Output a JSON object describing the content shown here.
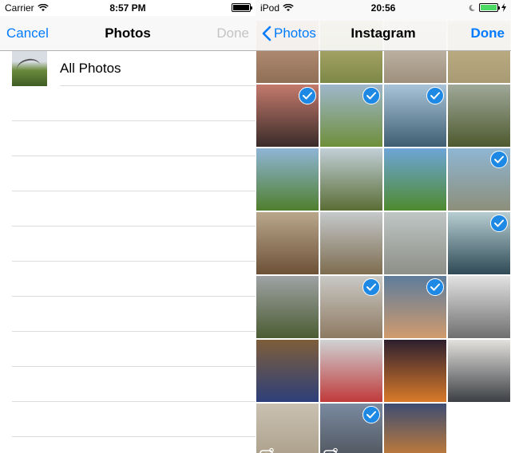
{
  "left": {
    "status": {
      "carrier": "Carrier",
      "time": "8:57 PM"
    },
    "nav": {
      "left": "Cancel",
      "title": "Photos",
      "right": "Done"
    },
    "albums": [
      {
        "label": "All Photos"
      }
    ]
  },
  "right": {
    "status": {
      "device": "iPod",
      "time": "20:56"
    },
    "nav": {
      "back": "Photos",
      "title": "Instagram",
      "right": "Done"
    },
    "photos": [
      {
        "colors": [
          "#caa089",
          "#8f6f55"
        ],
        "selected": false,
        "instagram": false
      },
      {
        "colors": [
          "#c7b87f",
          "#7c8847"
        ],
        "selected": false,
        "instagram": false
      },
      {
        "colors": [
          "#d8d0c4",
          "#9d8f7b"
        ],
        "selected": false,
        "instagram": false
      },
      {
        "colors": [
          "#c8b88e",
          "#a89a73"
        ],
        "selected": false,
        "instagram": false
      },
      {
        "colors": [
          "#c47a6c",
          "#3a2b29"
        ],
        "selected": true,
        "instagram": false
      },
      {
        "colors": [
          "#9eb7cc",
          "#6f8f3a"
        ],
        "selected": true,
        "instagram": false
      },
      {
        "colors": [
          "#a9c4d8",
          "#3f5e72"
        ],
        "selected": true,
        "instagram": false
      },
      {
        "colors": [
          "#a0a899",
          "#4e5a2f"
        ],
        "selected": false,
        "instagram": false
      },
      {
        "colors": [
          "#8fb5d6",
          "#4f7f2d"
        ],
        "selected": false,
        "instagram": false
      },
      {
        "colors": [
          "#c1cfd7",
          "#5a6d35"
        ],
        "selected": false,
        "instagram": false
      },
      {
        "colors": [
          "#6ea5d8",
          "#4e8a2e"
        ],
        "selected": false,
        "instagram": false
      },
      {
        "colors": [
          "#8eb6d3",
          "#8d8f7a"
        ],
        "selected": true,
        "instagram": false
      },
      {
        "colors": [
          "#b9a78c",
          "#6d5137"
        ],
        "selected": false,
        "instagram": false
      },
      {
        "colors": [
          "#c5c9cb",
          "#7d6c4f"
        ],
        "selected": false,
        "instagram": false
      },
      {
        "colors": [
          "#bfc6c4",
          "#8d8f88"
        ],
        "selected": false,
        "instagram": false
      },
      {
        "colors": [
          "#b6cdd1",
          "#2f4a56"
        ],
        "selected": true,
        "instagram": false
      },
      {
        "colors": [
          "#9fa2a4",
          "#4b5c33"
        ],
        "selected": false,
        "instagram": false
      },
      {
        "colors": [
          "#c9c9c5",
          "#8e7a62"
        ],
        "selected": true,
        "instagram": false
      },
      {
        "colors": [
          "#5d7c9c",
          "#d19b6d"
        ],
        "selected": true,
        "instagram": false
      },
      {
        "colors": [
          "#e2e2e2",
          "#6f6f6f"
        ],
        "selected": false,
        "instagram": false
      },
      {
        "colors": [
          "#7e5e3a",
          "#2d3f7a"
        ],
        "selected": false,
        "instagram": false
      },
      {
        "colors": [
          "#cfd2d4",
          "#c03a3a"
        ],
        "selected": false,
        "instagram": false
      },
      {
        "colors": [
          "#2d1f2e",
          "#d97a2a"
        ],
        "selected": false,
        "instagram": false
      },
      {
        "colors": [
          "#e3e1dd",
          "#3c3f44"
        ],
        "selected": false,
        "instagram": false
      },
      {
        "colors": [
          "#c9c1b2",
          "#a89b84"
        ],
        "selected": false,
        "instagram": true
      },
      {
        "colors": [
          "#7a8aa0",
          "#4a4e54"
        ],
        "selected": true,
        "instagram": true
      },
      {
        "colors": [
          "#3e4d73",
          "#d8842f"
        ],
        "selected": false,
        "instagram": false
      }
    ]
  },
  "colors": {
    "tint": "#007aff",
    "check": "#1e88e5",
    "disabled": "#c4c4c4"
  }
}
